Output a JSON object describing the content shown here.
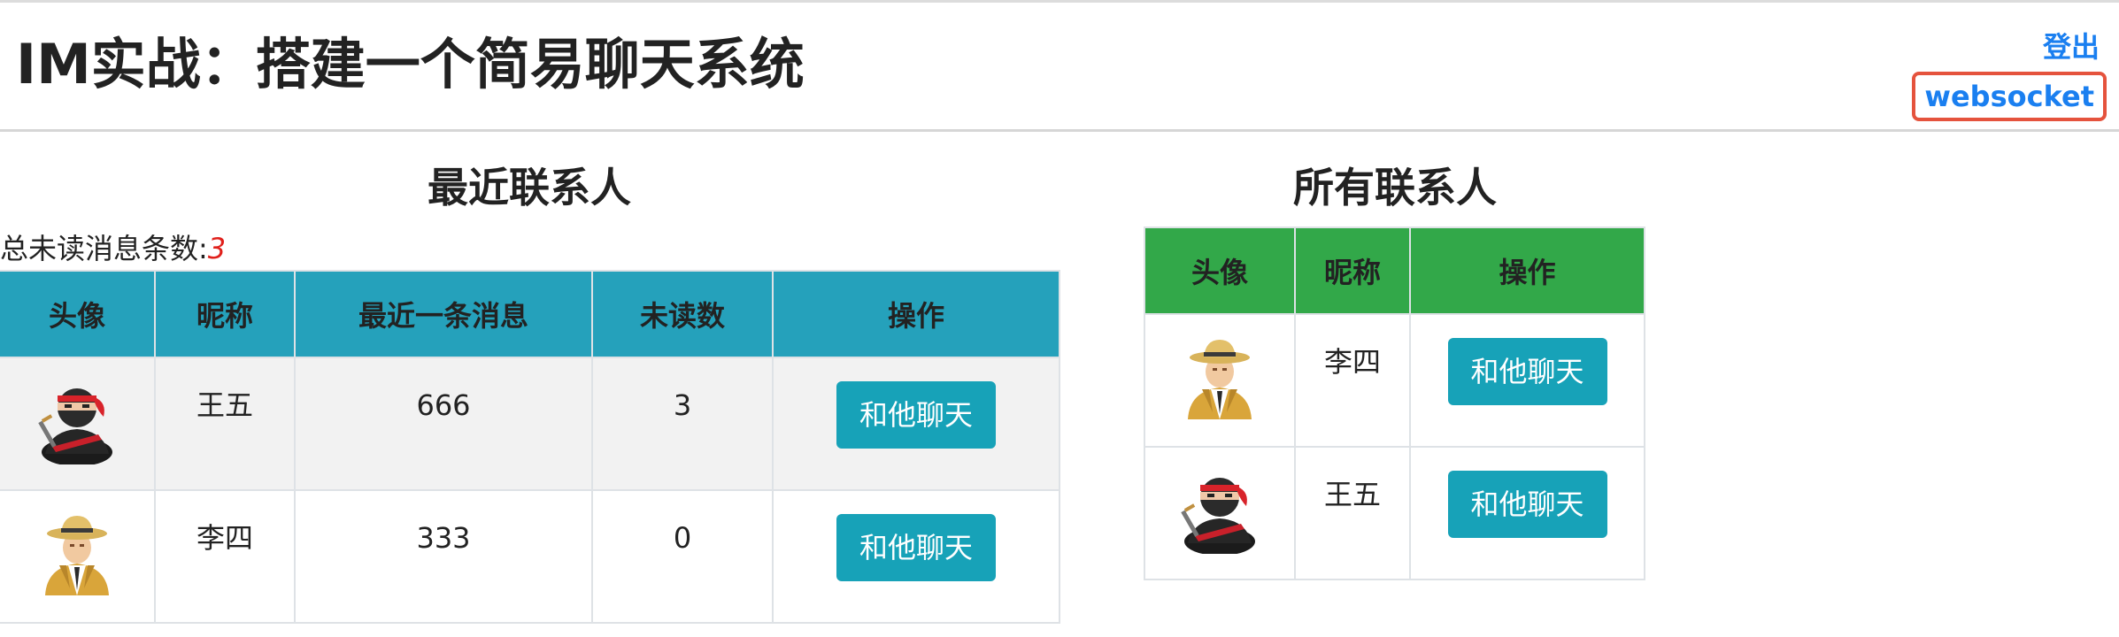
{
  "header": {
    "title": "IM实战：搭建一个简易聊天系统",
    "logout_label": "登出",
    "websocket_label": "websocket"
  },
  "recent": {
    "title": "最近联系人",
    "unread_label": "总未读消息条数:",
    "unread_total": "3",
    "columns": [
      "头像",
      "昵称",
      "最近一条消息",
      "未读数",
      "操作"
    ],
    "rows": [
      {
        "avatar": "ninja-avatar-icon",
        "nickname": "王五",
        "last_message": "666",
        "unread": "3",
        "action": "和他聊天"
      },
      {
        "avatar": "detective-avatar-icon",
        "nickname": "李四",
        "last_message": "333",
        "unread": "0",
        "action": "和他聊天"
      }
    ]
  },
  "all": {
    "title": "所有联系人",
    "columns": [
      "头像",
      "昵称",
      "操作"
    ],
    "rows": [
      {
        "avatar": "detective-avatar-icon",
        "nickname": "李四",
        "action": "和他聊天"
      },
      {
        "avatar": "ninja-avatar-icon",
        "nickname": "王五",
        "action": "和他聊天"
      }
    ]
  },
  "colors": {
    "recent_header": "#25a1bb",
    "all_header": "#32a849",
    "button": "#17a2b8",
    "link": "#1a7ff0",
    "highlight_border": "#e5533d",
    "unread_count": "#e0201b"
  }
}
